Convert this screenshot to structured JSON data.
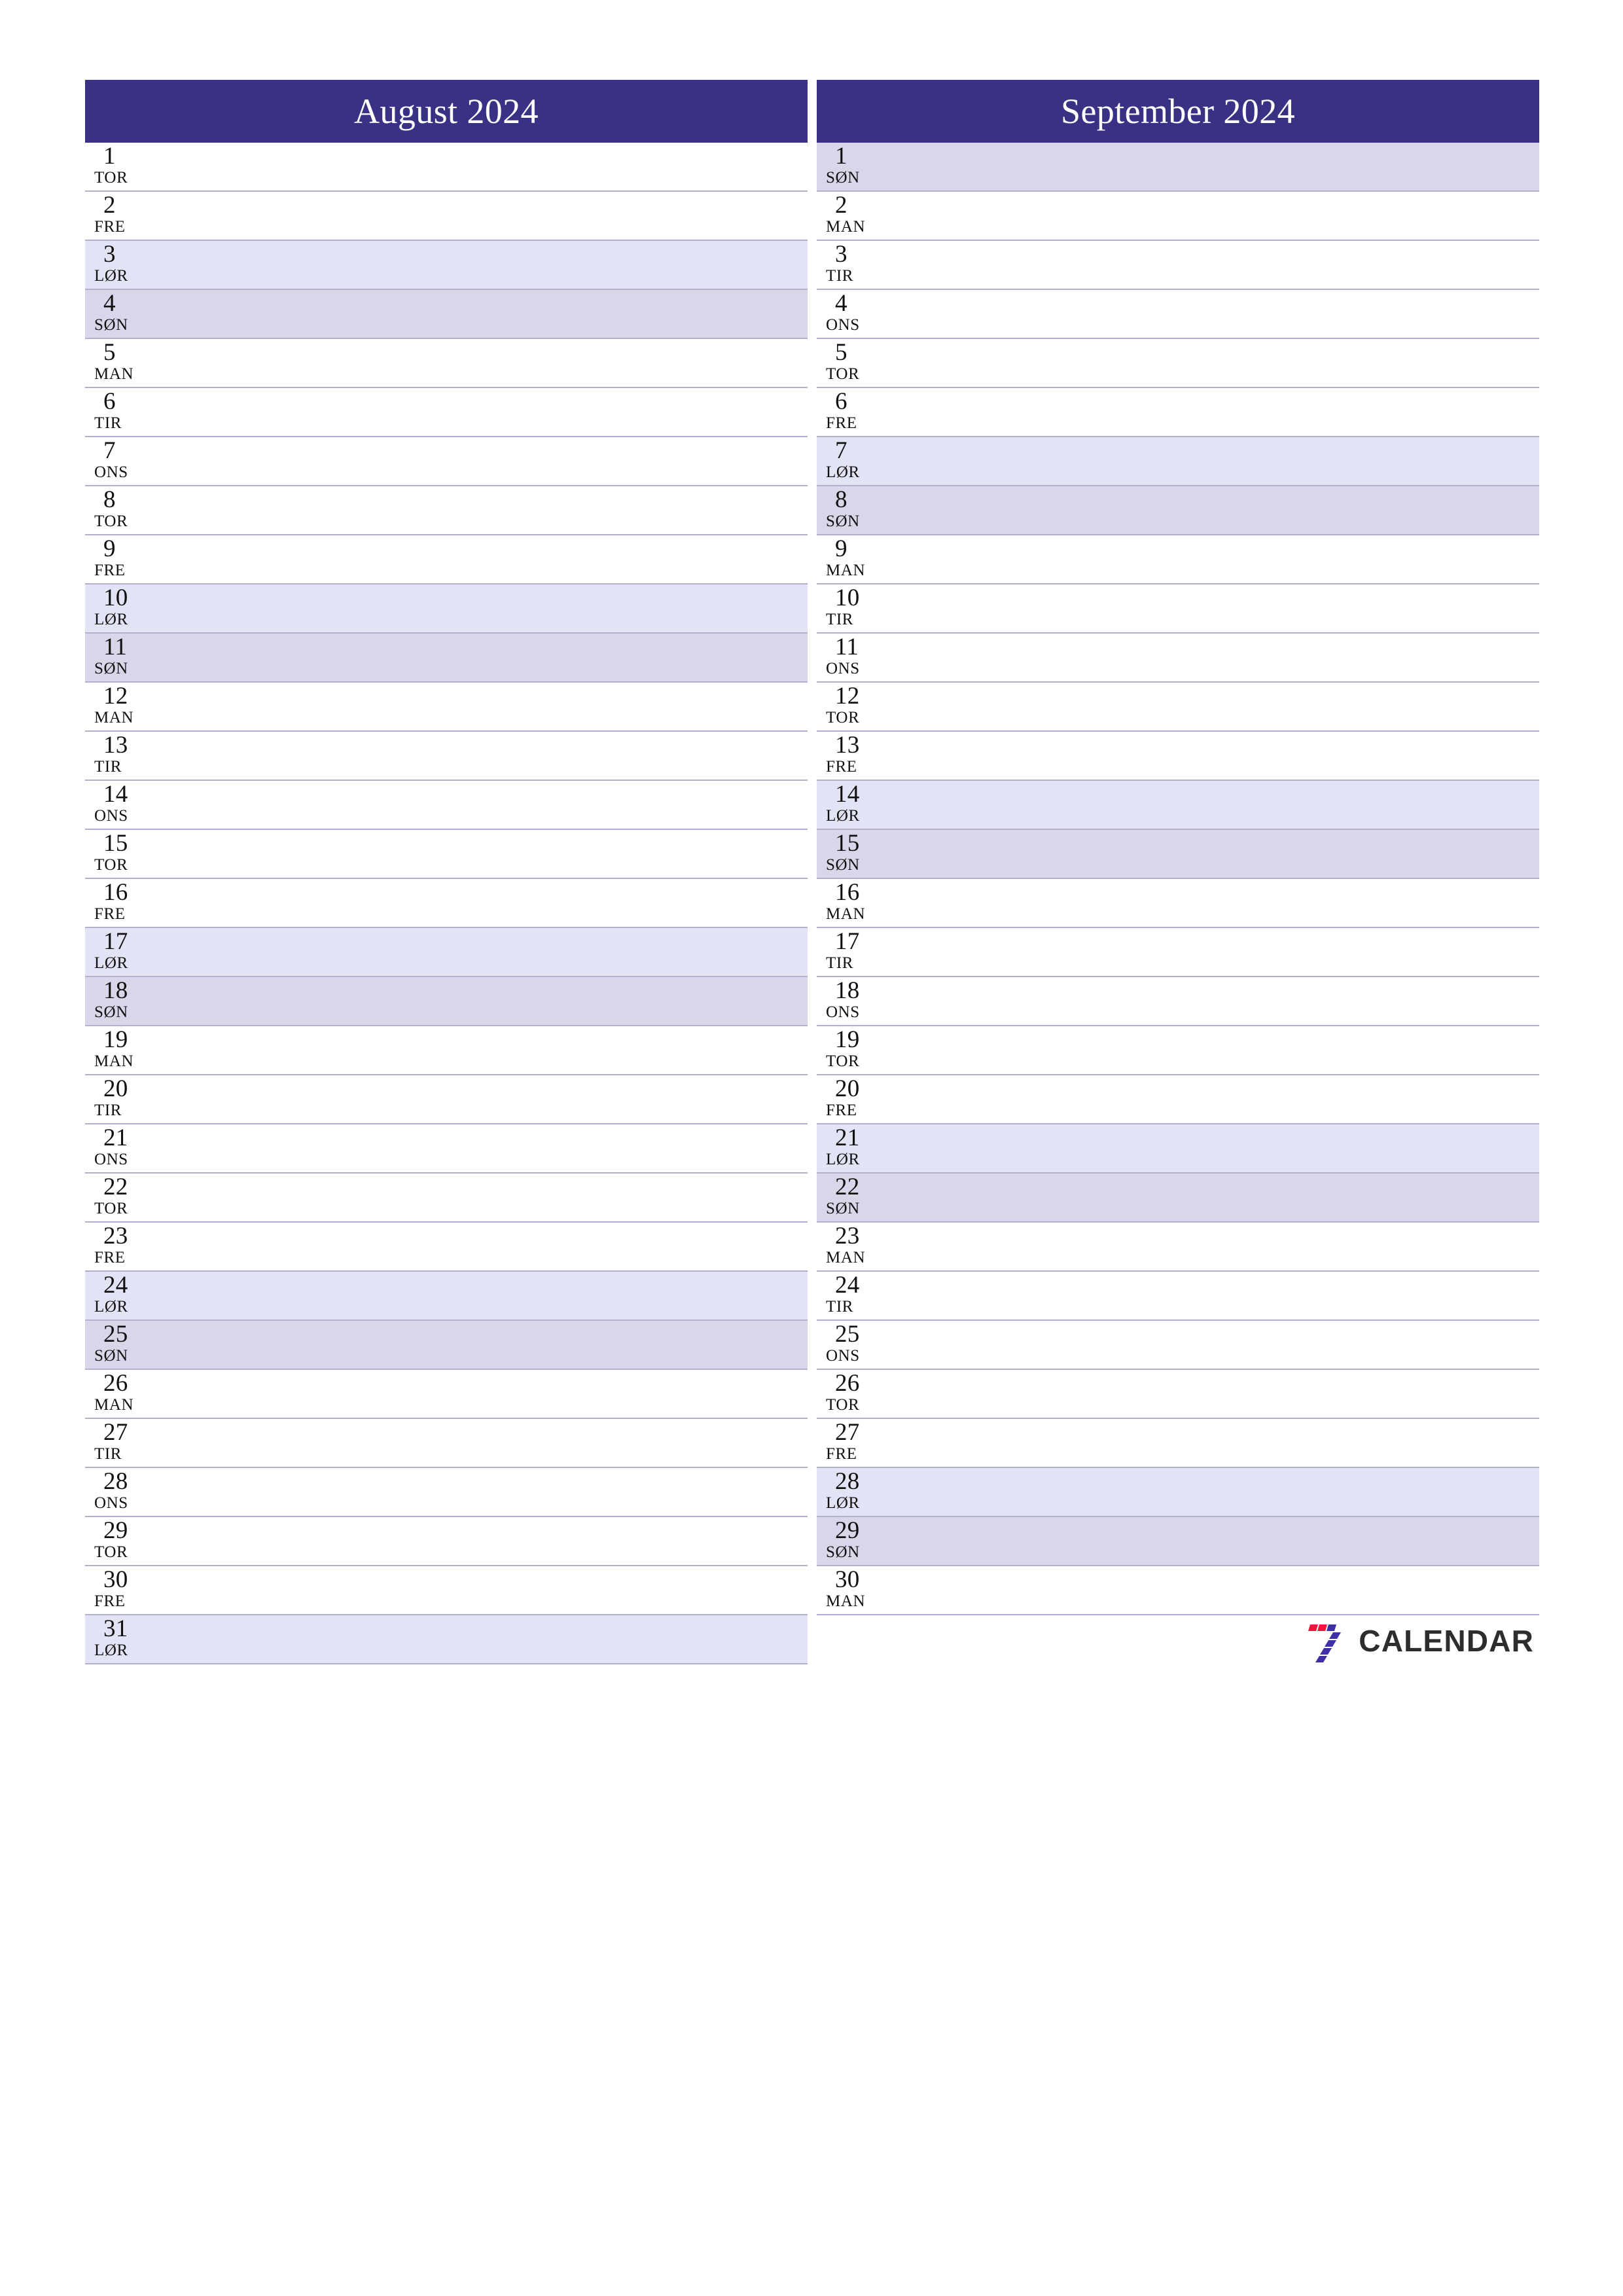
{
  "page": {
    "background_color": "#ffffff",
    "accent_color": "#393184",
    "saturday_color": "#e3e3f6",
    "sunday_color": "#dad6ea",
    "divider_color": "#b2b0ce"
  },
  "brand": {
    "name": "CALENDAR",
    "mark_name": "seven-logo-icon",
    "mark_colors": {
      "red": "#f4123f",
      "purple": "#3f2fa8"
    }
  },
  "months": [
    {
      "title": "August 2024",
      "days": [
        {
          "num": "1",
          "abbr": "TOR",
          "type": "weekday"
        },
        {
          "num": "2",
          "abbr": "FRE",
          "type": "weekday"
        },
        {
          "num": "3",
          "abbr": "LØR",
          "type": "sat"
        },
        {
          "num": "4",
          "abbr": "SØN",
          "type": "sun"
        },
        {
          "num": "5",
          "abbr": "MAN",
          "type": "weekday"
        },
        {
          "num": "6",
          "abbr": "TIR",
          "type": "weekday"
        },
        {
          "num": "7",
          "abbr": "ONS",
          "type": "weekday"
        },
        {
          "num": "8",
          "abbr": "TOR",
          "type": "weekday"
        },
        {
          "num": "9",
          "abbr": "FRE",
          "type": "weekday"
        },
        {
          "num": "10",
          "abbr": "LØR",
          "type": "sat"
        },
        {
          "num": "11",
          "abbr": "SØN",
          "type": "sun"
        },
        {
          "num": "12",
          "abbr": "MAN",
          "type": "weekday"
        },
        {
          "num": "13",
          "abbr": "TIR",
          "type": "weekday"
        },
        {
          "num": "14",
          "abbr": "ONS",
          "type": "weekday"
        },
        {
          "num": "15",
          "abbr": "TOR",
          "type": "weekday"
        },
        {
          "num": "16",
          "abbr": "FRE",
          "type": "weekday"
        },
        {
          "num": "17",
          "abbr": "LØR",
          "type": "sat"
        },
        {
          "num": "18",
          "abbr": "SØN",
          "type": "sun"
        },
        {
          "num": "19",
          "abbr": "MAN",
          "type": "weekday"
        },
        {
          "num": "20",
          "abbr": "TIR",
          "type": "weekday"
        },
        {
          "num": "21",
          "abbr": "ONS",
          "type": "weekday"
        },
        {
          "num": "22",
          "abbr": "TOR",
          "type": "weekday"
        },
        {
          "num": "23",
          "abbr": "FRE",
          "type": "weekday"
        },
        {
          "num": "24",
          "abbr": "LØR",
          "type": "sat"
        },
        {
          "num": "25",
          "abbr": "SØN",
          "type": "sun"
        },
        {
          "num": "26",
          "abbr": "MAN",
          "type": "weekday"
        },
        {
          "num": "27",
          "abbr": "TIR",
          "type": "weekday"
        },
        {
          "num": "28",
          "abbr": "ONS",
          "type": "weekday"
        },
        {
          "num": "29",
          "abbr": "TOR",
          "type": "weekday"
        },
        {
          "num": "30",
          "abbr": "FRE",
          "type": "weekday"
        },
        {
          "num": "31",
          "abbr": "LØR",
          "type": "sat"
        }
      ]
    },
    {
      "title": "September 2024",
      "days": [
        {
          "num": "1",
          "abbr": "SØN",
          "type": "sun"
        },
        {
          "num": "2",
          "abbr": "MAN",
          "type": "weekday"
        },
        {
          "num": "3",
          "abbr": "TIR",
          "type": "weekday"
        },
        {
          "num": "4",
          "abbr": "ONS",
          "type": "weekday"
        },
        {
          "num": "5",
          "abbr": "TOR",
          "type": "weekday"
        },
        {
          "num": "6",
          "abbr": "FRE",
          "type": "weekday"
        },
        {
          "num": "7",
          "abbr": "LØR",
          "type": "sat"
        },
        {
          "num": "8",
          "abbr": "SØN",
          "type": "sun"
        },
        {
          "num": "9",
          "abbr": "MAN",
          "type": "weekday"
        },
        {
          "num": "10",
          "abbr": "TIR",
          "type": "weekday"
        },
        {
          "num": "11",
          "abbr": "ONS",
          "type": "weekday"
        },
        {
          "num": "12",
          "abbr": "TOR",
          "type": "weekday"
        },
        {
          "num": "13",
          "abbr": "FRE",
          "type": "weekday"
        },
        {
          "num": "14",
          "abbr": "LØR",
          "type": "sat"
        },
        {
          "num": "15",
          "abbr": "SØN",
          "type": "sun"
        },
        {
          "num": "16",
          "abbr": "MAN",
          "type": "weekday"
        },
        {
          "num": "17",
          "abbr": "TIR",
          "type": "weekday"
        },
        {
          "num": "18",
          "abbr": "ONS",
          "type": "weekday"
        },
        {
          "num": "19",
          "abbr": "TOR",
          "type": "weekday"
        },
        {
          "num": "20",
          "abbr": "FRE",
          "type": "weekday"
        },
        {
          "num": "21",
          "abbr": "LØR",
          "type": "sat"
        },
        {
          "num": "22",
          "abbr": "SØN",
          "type": "sun"
        },
        {
          "num": "23",
          "abbr": "MAN",
          "type": "weekday"
        },
        {
          "num": "24",
          "abbr": "TIR",
          "type": "weekday"
        },
        {
          "num": "25",
          "abbr": "ONS",
          "type": "weekday"
        },
        {
          "num": "26",
          "abbr": "TOR",
          "type": "weekday"
        },
        {
          "num": "27",
          "abbr": "FRE",
          "type": "weekday"
        },
        {
          "num": "28",
          "abbr": "LØR",
          "type": "sat"
        },
        {
          "num": "29",
          "abbr": "SØN",
          "type": "sun"
        },
        {
          "num": "30",
          "abbr": "MAN",
          "type": "weekday"
        }
      ]
    }
  ]
}
